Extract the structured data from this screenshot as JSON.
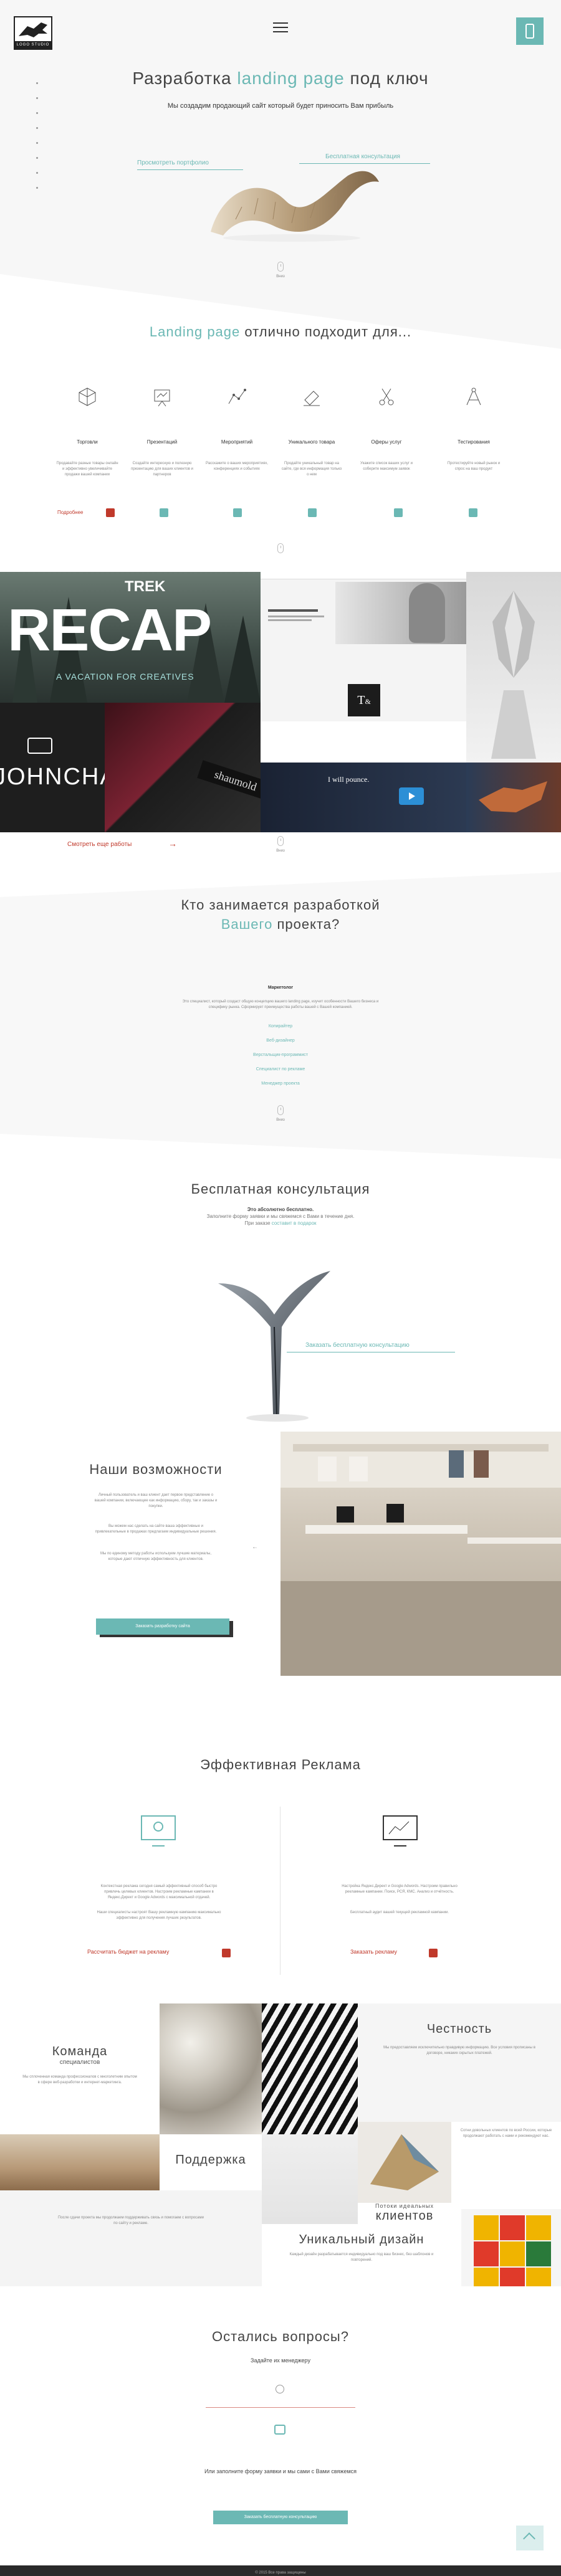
{
  "header": {
    "logo_text": "LOGO STUDIO",
    "menu_icon": "hamburger-icon",
    "action_icon": "phone-icon"
  },
  "hero": {
    "title_part1": "Разработка",
    "title_highlight": "landing page",
    "title_part2": "под ключ",
    "subtitle": "Мы создадим продающий сайт который будет приносить Вам прибыль",
    "portfolio_link": "Просмотреть портфолио",
    "consult_link": "Бесплатная консультация",
    "scroll_label": "Вниз"
  },
  "fit": {
    "title_highlight": "Landing page",
    "title_rest": "отлично подходит для...",
    "items": [
      {
        "title": "Торговли",
        "icon": "cube-icon",
        "text": "Продавайте разные товары онлайн и эффективно увеличивайте продажи вашей компании"
      },
      {
        "title": "Презентаций",
        "icon": "presentation-icon",
        "text": "Создайте интересную и полезную презентацию для ваших клиентов и партнеров"
      },
      {
        "title": "Мероприятий",
        "icon": "graph-icon",
        "text": "Расскажите о ваших мероприятиях, конференциях и событиях"
      },
      {
        "title": "Уникального товара",
        "icon": "eraser-icon",
        "text": "Продайте уникальный товар на сайте, где вся информация только о нем"
      },
      {
        "title": "Оферы услуг",
        "icon": "scissors-icon",
        "text": "Укажите список ваших услуг и соберите максимум заявок"
      },
      {
        "title": "Тестирования",
        "icon": "compass-icon",
        "text": "Протестируйте новый рынок и спрос на ваш продукт"
      }
    ],
    "more_label": "Подробнее"
  },
  "portfolio": {
    "tile1_a": "TREK",
    "tile1_b": "RECAP",
    "tile1_c": "A VACATION FOR CREATIVES",
    "tile2_name": "JOHNCHAR",
    "tile5_text": "I will pounce.",
    "more_link": "Смотреть еще работы",
    "scroll_label": "Вниз"
  },
  "who": {
    "title_line1": "Кто занимается разработкой",
    "title_highlight": "Вашего",
    "title_rest": "проекта?",
    "tab_active": "Маркетолог",
    "description": "Это специалист, который создаст общую концепцию вашего landing page, изучит особенности Вашего бизнеса и специфику рынка. Сформирует преимущества работы вашей с Вашей компанией.",
    "roles": [
      "Копирайтер",
      "Веб-дизайнер",
      "Верстальщик-программист",
      "Специалист по рекламе",
      "Менеджер проекта"
    ],
    "scroll_label": "Вниз"
  },
  "consult": {
    "title": "Бесплатная консультация",
    "line1": "Это абсолютно бесплатно.",
    "line2": "Заполните форму заявки и мы свяжемся с Вами в течение дня.",
    "line3": "При заказе",
    "line3_link": "составит в подарок",
    "cta_link": "Заказать бесплатную консультацию"
  },
  "caps": {
    "title": "Наши возможности",
    "p1": "Личный пользователь и ваш клиент дает первое представление о вашей компании, включающее как информацию, сбору, так и заказы и покупки.",
    "p2": "Вы можем нас сделать на сайте ваша эффективные и привлекательные в продажах предлагаем индивидуальные решения.",
    "p3": "Мы по единому методу работы используем лучшие материалы, которые дают отличную эффективность для клиентов.",
    "button": "Заказать разработку сайта"
  },
  "ads": {
    "title": "Эффективная Реклама",
    "left_text": "Контекстная реклама сегодня самый эффективный способ быстро привлечь целевых клиентов. Настроим рекламные кампании в Яндекс.Директ и Google Adwords с максимальной отдачей.",
    "left_text2": "Наши специалисты настроят Вашу рекламную кампанию максимально эффективно для получения лучших результатов.",
    "left_link": "Рассчитать бюджет на рекламу",
    "right_text": "Настройка Яндекс.Директ и Google Adwords. Настроим правильно рекламные кампании. Поиск, РСЯ, КМС. Анализ и отчётность.",
    "right_text2": "Бесплатный аудит вашей текущей рекламной кампании.",
    "right_link": "Заказать рекламу"
  },
  "features": {
    "team_title": "Команда",
    "team_sub": "специалистов",
    "team_text": "Мы сплоченная команда профессионалов с многолетним опытом в сфере веб-разработки и интернет-маркетинга.",
    "honesty_title": "Честность",
    "honesty_text": "Мы предоставляем исключительно правдивую информацию. Все условия прописаны в договоре, никаких скрытых платежей.",
    "clients_text": "Сотни довольных клиентов по всей России, которые продолжают работать с нами и рекомендуют нас.",
    "clients_title1": "Потоки идеальных",
    "clients_title2": "клиентов",
    "support_title": "Поддержка",
    "support_text": "После сдачи проекта мы продолжаем поддерживать связь и помогаем с вопросами по сайту и рекламе.",
    "design_title": "Уникальный дизайн",
    "design_text": "Каждый дизайн разрабатывается индивидуально под ваш бизнес, без шаблонов и повторений."
  },
  "contact": {
    "title": "Остались вопросы?",
    "ask_label": "Задайте их менеджеру",
    "or_text": "Или заполните форму заявки и мы сами с Вами свяжемся",
    "button": "Заказать бесплатную консультацию"
  },
  "footer": {
    "copyright": "© 2015 Все права защищены"
  },
  "colors": {
    "accent": "#6bb8b4",
    "red_icon": "#c0392b",
    "dark": "#2a2a2a"
  }
}
